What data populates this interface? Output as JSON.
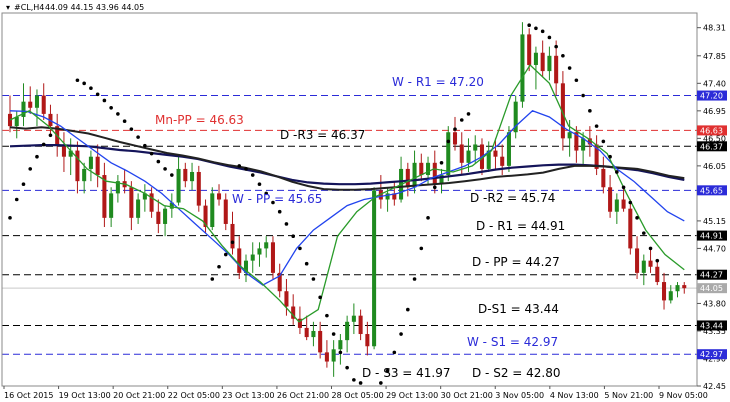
{
  "header": {
    "symbol": "#CL,H4",
    "values": "44.09 44.15 43.96 44.05"
  },
  "colors": {
    "black": "#000000",
    "blue": "#2b2bd8",
    "red": "#e03030",
    "candle_green": "#1f8a1f",
    "candle_red": "#b01818",
    "ma_fast": "#2a9b2a",
    "ma_mid": "#2244ee",
    "ma_navy": "#14145a",
    "ma_black": "#222222",
    "grid": "#c9c9c9"
  },
  "chart_data": {
    "type": "candlestick",
    "symbol": "#CL",
    "timeframe": "H4",
    "ylim": [
      42.45,
      48.55
    ],
    "x_ticks": [
      "16 Oct 2015",
      "19 Oct 13:00",
      "20 Oct 21:00",
      "22 Oct 05:00",
      "23 Oct 13:00",
      "26 Oct 21:00",
      "28 Oct 05:00",
      "29 Oct 13:00",
      "30 Oct 21:00",
      "3 Nov 05:00",
      "4 Nov 13:00",
      "5 Nov 21:00",
      "9 Nov 05:00"
    ],
    "y_ticks": [
      "48.31",
      "47.85",
      "47.40",
      "46.95",
      "46.50",
      "46.05",
      "45.15",
      "44.70",
      "43.80",
      "43.35",
      "42.90",
      "42.45"
    ],
    "current_price": "44.05",
    "levels": [
      {
        "label": "W - R1 = 47.20",
        "value": 47.2,
        "tag": "47.20",
        "color": "blue",
        "style": "dashed",
        "text_color": "blue"
      },
      {
        "label": "Mn-PP = 46.63",
        "value": 46.63,
        "tag": "46.63",
        "color": "red",
        "style": "dashed",
        "text_color": "red"
      },
      {
        "label": "D -R3 = 46.37",
        "value": 46.37,
        "tag": "46.37",
        "color": "black",
        "style": "dashed",
        "text_color": "black"
      },
      {
        "label": "W - PP = 45.65",
        "value": 45.65,
        "tag": "45.65",
        "color": "blue",
        "style": "dashed",
        "text_color": "blue"
      },
      {
        "label": "D -R2 = 45.74",
        "value": 45.74,
        "tag": "",
        "color": "black",
        "style": "none",
        "text_color": "black"
      },
      {
        "label": "D - R1 = 44.91",
        "value": 44.91,
        "tag": "44.91",
        "color": "black",
        "style": "dashed",
        "text_color": "black"
      },
      {
        "label": "D - PP = 44.27",
        "value": 44.27,
        "tag": "44.27",
        "color": "black",
        "style": "dashed",
        "text_color": "black"
      },
      {
        "label": "D-S1 = 43.44",
        "value": 43.44,
        "tag": "43.44",
        "color": "black",
        "style": "dashed",
        "text_color": "black"
      },
      {
        "label": "W - S1 = 42.97",
        "value": 42.97,
        "tag": "42.97",
        "color": "blue",
        "style": "dashed",
        "text_color": "blue"
      },
      {
        "label": "D - S3 = 41.97",
        "value": 41.97,
        "tag": "",
        "color": "black",
        "style": "none",
        "text_color": "black"
      },
      {
        "label": "D - S2 = 42.80",
        "value": 42.8,
        "tag": "",
        "color": "black",
        "style": "none",
        "text_color": "black"
      }
    ],
    "candles": [
      [
        46.9,
        47.2,
        46.6,
        46.7
      ],
      [
        46.7,
        46.95,
        46.5,
        46.85
      ],
      [
        46.85,
        47.4,
        46.7,
        47.1
      ],
      [
        47.1,
        47.35,
        46.9,
        47.0
      ],
      [
        47.0,
        47.3,
        46.7,
        47.2
      ],
      [
        47.2,
        47.4,
        46.8,
        46.9
      ],
      [
        46.9,
        47.05,
        46.55,
        46.7
      ],
      [
        46.7,
        46.9,
        46.2,
        46.4
      ],
      [
        46.4,
        46.6,
        45.95,
        46.2
      ],
      [
        46.2,
        46.5,
        45.9,
        46.3
      ],
      [
        46.3,
        46.45,
        45.6,
        45.8
      ],
      [
        45.8,
        46.1,
        45.6,
        46.0
      ],
      [
        46.0,
        46.3,
        45.8,
        46.2
      ],
      [
        46.2,
        46.4,
        45.7,
        45.9
      ],
      [
        45.9,
        46.1,
        45.05,
        45.2
      ],
      [
        45.2,
        45.7,
        45.05,
        45.6
      ],
      [
        45.6,
        45.9,
        45.45,
        45.8
      ],
      [
        45.8,
        46.0,
        45.6,
        45.7
      ],
      [
        45.7,
        45.8,
        45.0,
        45.2
      ],
      [
        45.2,
        45.6,
        45.1,
        45.5
      ],
      [
        45.5,
        45.75,
        45.3,
        45.6
      ],
      [
        45.6,
        45.7,
        45.2,
        45.3
      ],
      [
        45.3,
        45.5,
        44.95,
        45.1
      ],
      [
        45.1,
        45.4,
        44.9,
        45.35
      ],
      [
        45.35,
        45.6,
        45.2,
        45.45
      ],
      [
        45.45,
        46.2,
        45.4,
        46.0
      ],
      [
        46.0,
        46.1,
        45.7,
        45.8
      ],
      [
        45.8,
        46.1,
        45.65,
        45.95
      ],
      [
        45.95,
        46.05,
        45.3,
        45.4
      ],
      [
        45.4,
        45.5,
        44.95,
        45.05
      ],
      [
        45.05,
        45.7,
        45.0,
        45.6
      ],
      [
        45.6,
        45.75,
        45.4,
        45.5
      ],
      [
        45.5,
        45.6,
        45.0,
        45.1
      ],
      [
        45.1,
        45.3,
        44.6,
        44.7
      ],
      [
        44.7,
        44.9,
        44.2,
        44.3
      ],
      [
        44.3,
        44.6,
        44.15,
        44.5
      ],
      [
        44.5,
        44.8,
        44.3,
        44.6
      ],
      [
        44.6,
        44.8,
        44.4,
        44.7
      ],
      [
        44.7,
        44.9,
        44.55,
        44.8
      ],
      [
        44.8,
        44.9,
        44.2,
        44.3
      ],
      [
        44.3,
        44.45,
        43.9,
        44.0
      ],
      [
        44.0,
        44.2,
        43.6,
        43.75
      ],
      [
        43.75,
        43.95,
        43.45,
        43.55
      ],
      [
        43.55,
        43.75,
        43.3,
        43.4
      ],
      [
        43.4,
        43.6,
        43.2,
        43.25
      ],
      [
        43.25,
        43.5,
        43.1,
        43.35
      ],
      [
        43.35,
        43.5,
        42.9,
        43.0
      ],
      [
        43.0,
        43.2,
        42.75,
        42.85
      ],
      [
        42.85,
        43.2,
        42.6,
        43.05
      ],
      [
        43.05,
        43.3,
        42.8,
        43.2
      ],
      [
        43.2,
        43.6,
        43.0,
        43.5
      ],
      [
        43.5,
        43.8,
        43.3,
        43.6
      ],
      [
        43.6,
        43.7,
        43.2,
        43.3
      ],
      [
        43.3,
        43.5,
        42.95,
        43.1
      ],
      [
        43.1,
        45.7,
        43.05,
        45.65
      ],
      [
        45.65,
        45.9,
        45.35,
        45.5
      ],
      [
        45.5,
        45.7,
        45.3,
        45.6
      ],
      [
        45.6,
        45.8,
        45.4,
        45.5
      ],
      [
        45.5,
        46.2,
        45.45,
        46.0
      ],
      [
        46.0,
        46.1,
        45.55,
        45.7
      ],
      [
        45.7,
        46.3,
        45.6,
        46.1
      ],
      [
        46.1,
        46.25,
        45.8,
        45.9
      ],
      [
        45.9,
        46.2,
        45.75,
        46.1
      ],
      [
        46.1,
        46.3,
        45.6,
        45.75
      ],
      [
        45.75,
        46.0,
        45.6,
        45.9
      ],
      [
        45.9,
        46.7,
        45.8,
        46.6
      ],
      [
        46.6,
        46.85,
        46.3,
        46.4
      ],
      [
        46.4,
        46.6,
        45.9,
        46.1
      ],
      [
        46.1,
        46.5,
        45.95,
        46.3
      ],
      [
        46.3,
        46.55,
        46.1,
        46.4
      ],
      [
        46.4,
        46.5,
        45.9,
        46.0
      ],
      [
        46.0,
        46.45,
        45.95,
        46.3
      ],
      [
        46.3,
        46.5,
        46.0,
        46.2
      ],
      [
        46.2,
        46.4,
        45.9,
        46.05
      ],
      [
        46.05,
        46.7,
        45.95,
        46.6
      ],
      [
        46.6,
        47.2,
        46.5,
        47.1
      ],
      [
        47.1,
        48.4,
        47.0,
        48.2
      ],
      [
        48.2,
        48.3,
        47.6,
        47.7
      ],
      [
        47.7,
        48.0,
        47.3,
        47.9
      ],
      [
        47.9,
        48.1,
        47.5,
        47.6
      ],
      [
        47.6,
        48.0,
        47.45,
        47.85
      ],
      [
        47.85,
        48.1,
        47.2,
        47.4
      ],
      [
        47.4,
        47.6,
        46.3,
        46.5
      ],
      [
        46.5,
        46.8,
        46.2,
        46.6
      ],
      [
        46.6,
        46.7,
        46.1,
        46.3
      ],
      [
        46.3,
        46.6,
        46.05,
        46.5
      ],
      [
        46.5,
        46.7,
        46.2,
        46.4
      ],
      [
        46.4,
        46.55,
        45.9,
        46.0
      ],
      [
        46.0,
        46.2,
        45.6,
        45.7
      ],
      [
        45.7,
        45.9,
        45.2,
        45.3
      ],
      [
        45.3,
        45.6,
        45.1,
        45.5
      ],
      [
        45.5,
        45.7,
        45.3,
        45.35
      ],
      [
        45.35,
        45.5,
        44.6,
        44.7
      ],
      [
        44.7,
        44.9,
        44.2,
        44.3
      ],
      [
        44.3,
        44.6,
        44.1,
        44.5
      ],
      [
        44.5,
        44.7,
        44.3,
        44.4
      ],
      [
        44.4,
        44.5,
        44.1,
        44.15
      ],
      [
        44.15,
        44.3,
        43.7,
        43.85
      ],
      [
        43.85,
        44.1,
        43.8,
        44.0
      ],
      [
        44.0,
        44.15,
        43.9,
        44.1
      ],
      [
        44.1,
        44.15,
        43.96,
        44.05
      ]
    ],
    "ma_black": [
      46.68,
      46.66,
      46.68,
      46.66,
      46.62,
      46.58,
      46.51,
      46.44,
      46.38,
      46.32,
      46.26,
      46.22,
      46.17,
      46.11,
      46.06,
      46.02,
      45.96,
      45.88,
      45.79,
      45.72,
      45.67,
      45.66,
      45.66,
      45.67,
      45.69,
      45.71,
      45.73,
      45.75,
      45.77,
      45.8,
      45.83,
      45.87,
      45.89,
      45.91,
      45.94,
      46.0,
      46.05,
      46.05,
      46.04,
      46.02,
      46.0,
      45.95,
      45.89,
      45.85
    ],
    "ma_navy": [
      46.37,
      46.38,
      46.39,
      46.39,
      46.38,
      46.37,
      46.34,
      46.31,
      46.29,
      46.26,
      46.23,
      46.2,
      46.16,
      46.1,
      46.04,
      45.99,
      45.94,
      45.88,
      45.82,
      45.78,
      45.76,
      45.75,
      45.75,
      45.76,
      45.78,
      45.8,
      45.82,
      45.85,
      45.88,
      45.91,
      45.95,
      45.99,
      46.02,
      46.04,
      46.06,
      46.07,
      46.07,
      46.06,
      46.04,
      46.01,
      45.98,
      45.93,
      45.87,
      45.82
    ],
    "ma_blue": [
      46.95,
      46.94,
      46.85,
      46.7,
      46.5,
      46.3,
      46.1,
      45.96,
      45.8,
      45.6,
      45.35,
      45.1,
      44.85,
      44.6,
      44.3,
      44.1,
      44.25,
      44.7,
      45.0,
      45.2,
      45.4,
      45.5,
      45.55,
      45.6,
      45.7,
      45.85,
      45.95,
      46.05,
      46.2,
      46.4,
      46.7,
      46.95,
      46.85,
      46.65,
      46.5,
      46.3,
      46.0,
      45.8,
      45.55,
      45.3,
      45.15
    ],
    "ma_green": [
      46.8,
      46.95,
      46.7,
      46.35,
      46.0,
      45.8,
      45.75,
      45.6,
      45.4,
      45.35,
      45.15,
      44.75,
      44.4,
      44.15,
      43.85,
      43.5,
      43.7,
      44.9,
      45.3,
      45.55,
      45.7,
      45.85,
      46.0,
      45.95,
      46.05,
      46.3,
      47.2,
      47.7,
      47.4,
      46.7,
      46.5,
      46.25,
      45.6,
      45.0,
      44.6,
      44.35
    ],
    "psar_segments": [
      {
        "from": 0,
        "values": [
          45.2,
          45.5,
          45.75,
          46.0,
          46.2,
          46.4,
          46.55
        ]
      },
      {
        "from": 10,
        "values": [
          47.45,
          47.4,
          47.32,
          47.22,
          47.12,
          47.0,
          46.9,
          46.78,
          46.65,
          46.52,
          46.38,
          46.25,
          46.12,
          46.0,
          45.9
        ]
      },
      {
        "from": 30,
        "values": [
          44.2,
          44.4,
          44.6,
          44.8
        ]
      },
      {
        "from": 34,
        "values": [
          46.05,
          46.0,
          45.9,
          45.75,
          45.6,
          45.45,
          45.3,
          45.1,
          44.9,
          44.7,
          44.45,
          44.2,
          43.9,
          43.6,
          43.3,
          43.0,
          42.75,
          42.55,
          42.5
        ]
      },
      {
        "from": 55,
        "values": [
          42.5,
          42.7,
          43.0,
          43.3,
          43.7,
          44.2,
          44.7,
          45.2,
          45.7,
          46.1,
          46.45,
          46.65,
          46.8,
          46.9
        ]
      },
      {
        "from": 77,
        "values": [
          48.35,
          48.3,
          48.25,
          48.15,
          48.0,
          47.85,
          47.65,
          47.45,
          47.2,
          46.95,
          46.7,
          46.45,
          46.2,
          45.95,
          45.7,
          45.45,
          45.2,
          44.95,
          44.7,
          44.5
        ]
      }
    ]
  }
}
